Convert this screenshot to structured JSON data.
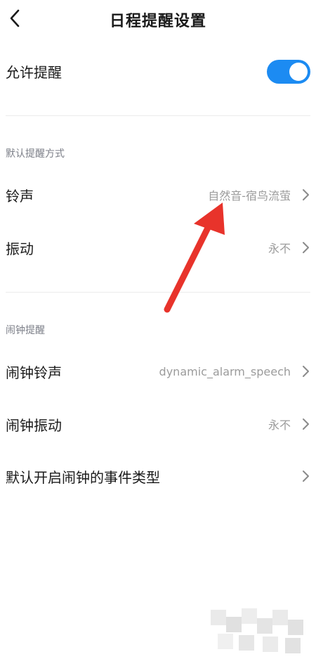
{
  "header": {
    "title": "日程提醒设置",
    "back_icon": "chevron-left-icon"
  },
  "allow_reminder": {
    "label": "允许提醒",
    "enabled": true
  },
  "section_default": {
    "title": "默认提醒方式",
    "items": [
      {
        "label": "铃声",
        "value": "自然音-宿鸟流萤"
      },
      {
        "label": "振动",
        "value": "永不"
      }
    ]
  },
  "section_alarm": {
    "title": "闹钟提醒",
    "items": [
      {
        "label": "闹钟铃声",
        "value": "dynamic_alarm_speech"
      },
      {
        "label": "闹钟振动",
        "value": "永不"
      },
      {
        "label": "默认开启闹钟的事件类型",
        "value": ""
      }
    ]
  },
  "colors": {
    "accent": "#1c8bf2",
    "annotation_arrow": "#e8332b",
    "secondary_text": "#9b9b9b",
    "section_title": "#7c7f88"
  }
}
